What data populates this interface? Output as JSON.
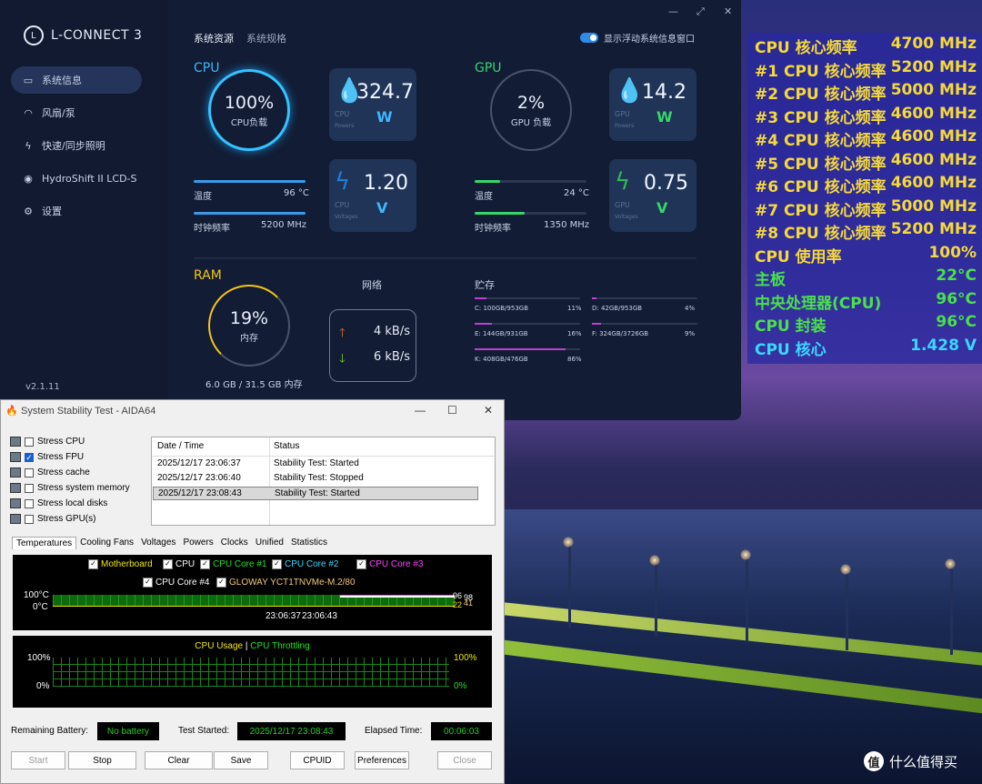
{
  "lconnect": {
    "app_title": "L-CONNECT 3",
    "version": "v2.1.11",
    "nav": [
      {
        "label": "系统信息",
        "icon": "monitor-icon"
      },
      {
        "label": "风扇/泵",
        "icon": "fan-icon"
      },
      {
        "label": "快速/同步照明",
        "icon": "lightning-icon"
      },
      {
        "label": "HydroShift II LCD-S",
        "icon": "cooler-icon"
      },
      {
        "label": "设置",
        "icon": "gear-icon"
      }
    ],
    "tabs": [
      "系统资源",
      "系统规格"
    ],
    "floating_toggle": "显示浮动系统信息窗口",
    "cpu": {
      "label": "CPU",
      "load": "100%",
      "load_label": "CPU负载",
      "power": "324.7",
      "power_unit": "W",
      "power_cap": "CPU",
      "power_sub": "Powers",
      "voltage": "1.20",
      "voltage_unit": "V",
      "volt_cap": "CPU",
      "volt_sub": "Voltages",
      "temp_label": "温度",
      "temp": "96 °C",
      "clock_label": "时钟频率",
      "clock": "5200 MHz"
    },
    "gpu": {
      "label": "GPU",
      "load": "2%",
      "load_label": "GPU 负载",
      "power": "14.2",
      "power_unit": "W",
      "power_cap": "GPU",
      "power_sub": "Powers",
      "voltage": "0.75",
      "voltage_unit": "V",
      "volt_cap": "GPU",
      "volt_sub": "Voltages",
      "temp_label": "温度",
      "temp": "24 °C",
      "clock_label": "时钟频率",
      "clock": "1350 MHz"
    },
    "ram": {
      "label": "RAM",
      "usage": "19%",
      "usage_label": "内存",
      "detail": "6.0 GB / 31.5 GB 内存"
    },
    "network": {
      "label": "网络",
      "up": "4 kB/s",
      "down": "6 kB/s"
    },
    "storage": {
      "label": "贮存",
      "drives": [
        {
          "name": "C: 100GB/953GB",
          "pct": "11%",
          "fill": 0.11
        },
        {
          "name": "D: 42GB/953GB",
          "pct": "4%",
          "fill": 0.04
        },
        {
          "name": "E: 144GB/931GB",
          "pct": "16%",
          "fill": 0.16
        },
        {
          "name": "F: 324GB/3726GB",
          "pct": "9%",
          "fill": 0.09
        },
        {
          "name": "K: 408GB/476GB",
          "pct": "86%",
          "fill": 0.86
        }
      ]
    }
  },
  "osd": {
    "rows": [
      {
        "label": "CPU 核心频率",
        "value": "4700 MHz",
        "color": "#f5d93a"
      },
      {
        "label": "#1 CPU 核心频率",
        "value": "5200 MHz",
        "color": "#f5d93a"
      },
      {
        "label": "#2 CPU 核心频率",
        "value": "5000 MHz",
        "color": "#f5d93a"
      },
      {
        "label": "#3 CPU 核心频率",
        "value": "4600 MHz",
        "color": "#f5d93a"
      },
      {
        "label": "#4 CPU 核心频率",
        "value": "4600 MHz",
        "color": "#f5d93a"
      },
      {
        "label": "#5 CPU 核心频率",
        "value": "4600 MHz",
        "color": "#f5d93a"
      },
      {
        "label": "#6 CPU 核心频率",
        "value": "4600 MHz",
        "color": "#f5d93a"
      },
      {
        "label": "#7 CPU 核心频率",
        "value": "5000 MHz",
        "color": "#f5d93a"
      },
      {
        "label": "#8 CPU 核心频率",
        "value": "5200 MHz",
        "color": "#f5d93a"
      },
      {
        "label": "CPU 使用率",
        "value": "100%",
        "color": "#f5d93a"
      },
      {
        "label": "主板",
        "value": "22°C",
        "color": "#4be04b"
      },
      {
        "label": "中央处理器(CPU)",
        "value": "96°C",
        "color": "#4be04b"
      },
      {
        "label": "CPU 封装",
        "value": "96°C",
        "color": "#4be04b"
      },
      {
        "label": "CPU 核心",
        "value": "1.428 V",
        "color": "#3ad8ff"
      }
    ]
  },
  "aida": {
    "title": "System Stability Test - AIDA64",
    "stress": [
      {
        "label": "Stress CPU",
        "checked": false
      },
      {
        "label": "Stress FPU",
        "checked": true
      },
      {
        "label": "Stress cache",
        "checked": false
      },
      {
        "label": "Stress system memory",
        "checked": false
      },
      {
        "label": "Stress local disks",
        "checked": false
      },
      {
        "label": "Stress GPU(s)",
        "checked": false
      }
    ],
    "log_headers": [
      "Date / Time",
      "Status"
    ],
    "log": [
      {
        "time": "2025/12/17 23:06:37",
        "status": "Stability Test: Started"
      },
      {
        "time": "2025/12/17 23:06:40",
        "status": "Stability Test: Stopped"
      },
      {
        "time": "2025/12/17 23:08:43",
        "status": "Stability Test: Started"
      }
    ],
    "tabs": [
      "Temperatures",
      "Cooling Fans",
      "Voltages",
      "Powers",
      "Clocks",
      "Unified",
      "Statistics"
    ],
    "temp_legend": [
      {
        "label": "Motherboard",
        "color": "#f2e600"
      },
      {
        "label": "CPU",
        "color": "#ffffff"
      },
      {
        "label": "CPU Core #1",
        "color": "#22e022"
      },
      {
        "label": "CPU Core #2",
        "color": "#3ad8ff"
      },
      {
        "label": "CPU Core #3",
        "color": "#ff44ff"
      },
      {
        "label": "CPU Core #4",
        "color": "#ffffff"
      },
      {
        "label": "GLOWAY YCT1TNVMe-M.2/80",
        "color": "#f2c87a"
      }
    ],
    "temp_axis": {
      "top": "100°C",
      "bottom": "0°C"
    },
    "temp_time": "23:06:37",
    "temp_time_overlap": "23:06:43",
    "temp_right": {
      "v1": "96",
      "v2": "98",
      "v3": "22",
      "v4": "41"
    },
    "usage_legend": {
      "a": "CPU Usage",
      "sep": "|",
      "b": "CPU Throttling"
    },
    "usage_axis": {
      "top": "100%",
      "bottom": "0%",
      "rtop": "100%",
      "rbottom": "0%"
    },
    "remaining_battery_label": "Remaining Battery:",
    "remaining_battery": "No battery",
    "test_started_label": "Test Started:",
    "test_started": "2025/12/17 23:08:43",
    "elapsed_label": "Elapsed Time:",
    "elapsed": "00:06:03",
    "buttons": {
      "start": "Start",
      "stop": "Stop",
      "clear": "Clear",
      "save": "Save",
      "cpuid": "CPUID",
      "prefs": "Preferences",
      "close": "Close"
    }
  },
  "watermark": {
    "logo": "值",
    "text": "什么值得买"
  }
}
